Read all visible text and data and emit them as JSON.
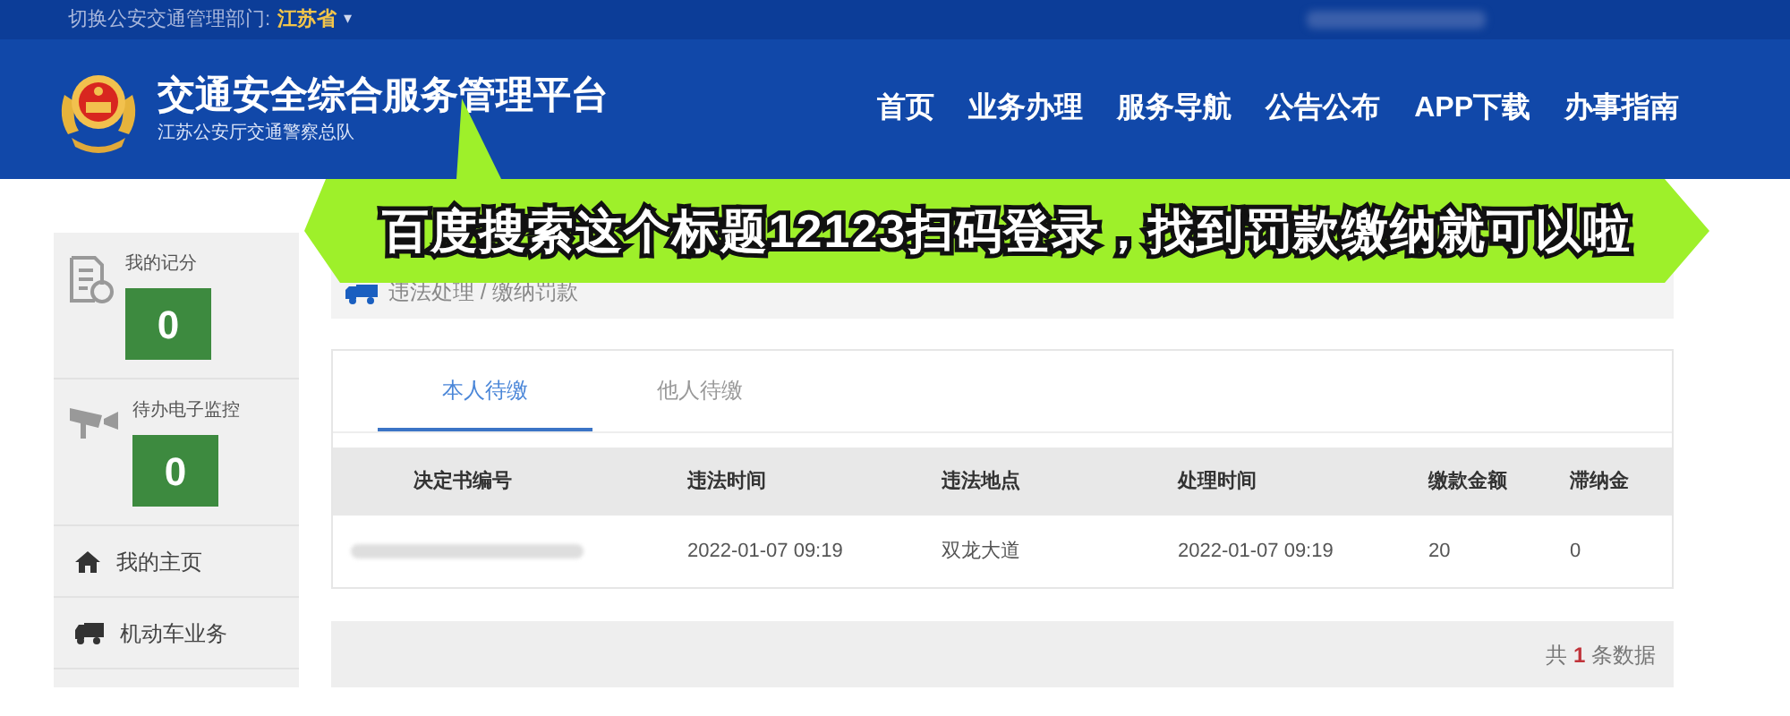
{
  "top_bar": {
    "label": "切换公安交通管理部门:",
    "region": "江苏省",
    "caret": "▾"
  },
  "header": {
    "title": "交通安全综合服务管理平台",
    "subtitle": "江苏公安厅交通警察总队",
    "nav": [
      {
        "label": "首页"
      },
      {
        "label": "业务办理"
      },
      {
        "label": "服务导航"
      },
      {
        "label": "公告公布"
      },
      {
        "label": "APP下载"
      },
      {
        "label": "办事指南"
      }
    ]
  },
  "caption": "百度搜索这个标题12123扫码登录，找到罚款缴纳就可以啦",
  "sidebar": {
    "stats": [
      {
        "kind": "points",
        "label": "我的记分",
        "value": "0"
      },
      {
        "kind": "camera",
        "label": "待办电子监控",
        "value": "0"
      }
    ],
    "items": [
      {
        "kind": "home",
        "label": "我的主页"
      },
      {
        "kind": "truck",
        "label": "机动车业务"
      }
    ]
  },
  "breadcrumb": "违法处理 / 缴纳罚款",
  "tabs": [
    {
      "label": "本人待缴",
      "selected": true
    },
    {
      "label": "他人待缴",
      "selected": false
    }
  ],
  "table": {
    "columns": [
      "决定书编号",
      "违法时间",
      "违法地点",
      "处理时间",
      "缴款金额",
      "滞纳金"
    ],
    "rows": [
      {
        "redacted": true,
        "cells": [
          "",
          "2022-01-07 09:19",
          "双龙大道",
          "2022-01-07 09:19",
          "20",
          "0"
        ]
      }
    ]
  },
  "footer": {
    "prefix": "共",
    "count": "1",
    "suffix": "条数据"
  }
}
